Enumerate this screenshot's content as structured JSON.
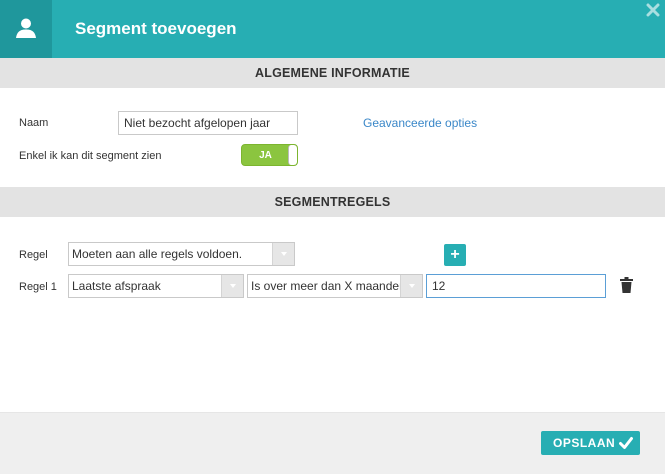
{
  "dialog": {
    "title": "Segment toevoegen",
    "icon": "user-icon",
    "accent_color": "#27aeb3"
  },
  "general": {
    "section_title": "ALGEMENE INFORMATIE",
    "name_label": "Naam",
    "name_value": "Niet bezocht afgelopen jaar",
    "advanced_link": "Geavanceerde opties",
    "private_label": "Enkel ik kan dit segment zien",
    "private_toggle": "JA",
    "toggle_color": "#8bc53f"
  },
  "rules": {
    "section_title": "SEGMENTREGELS",
    "rule_label": "Regel",
    "rule_mode": "Moeten aan alle regels voldoen.",
    "rule1_label": "Regel 1",
    "rule1_field": "Laatste afspraak",
    "rule1_operator": "Is over meer dan X maanden",
    "rule1_value": "12"
  },
  "footer": {
    "save_label": "OPSLAAN"
  }
}
